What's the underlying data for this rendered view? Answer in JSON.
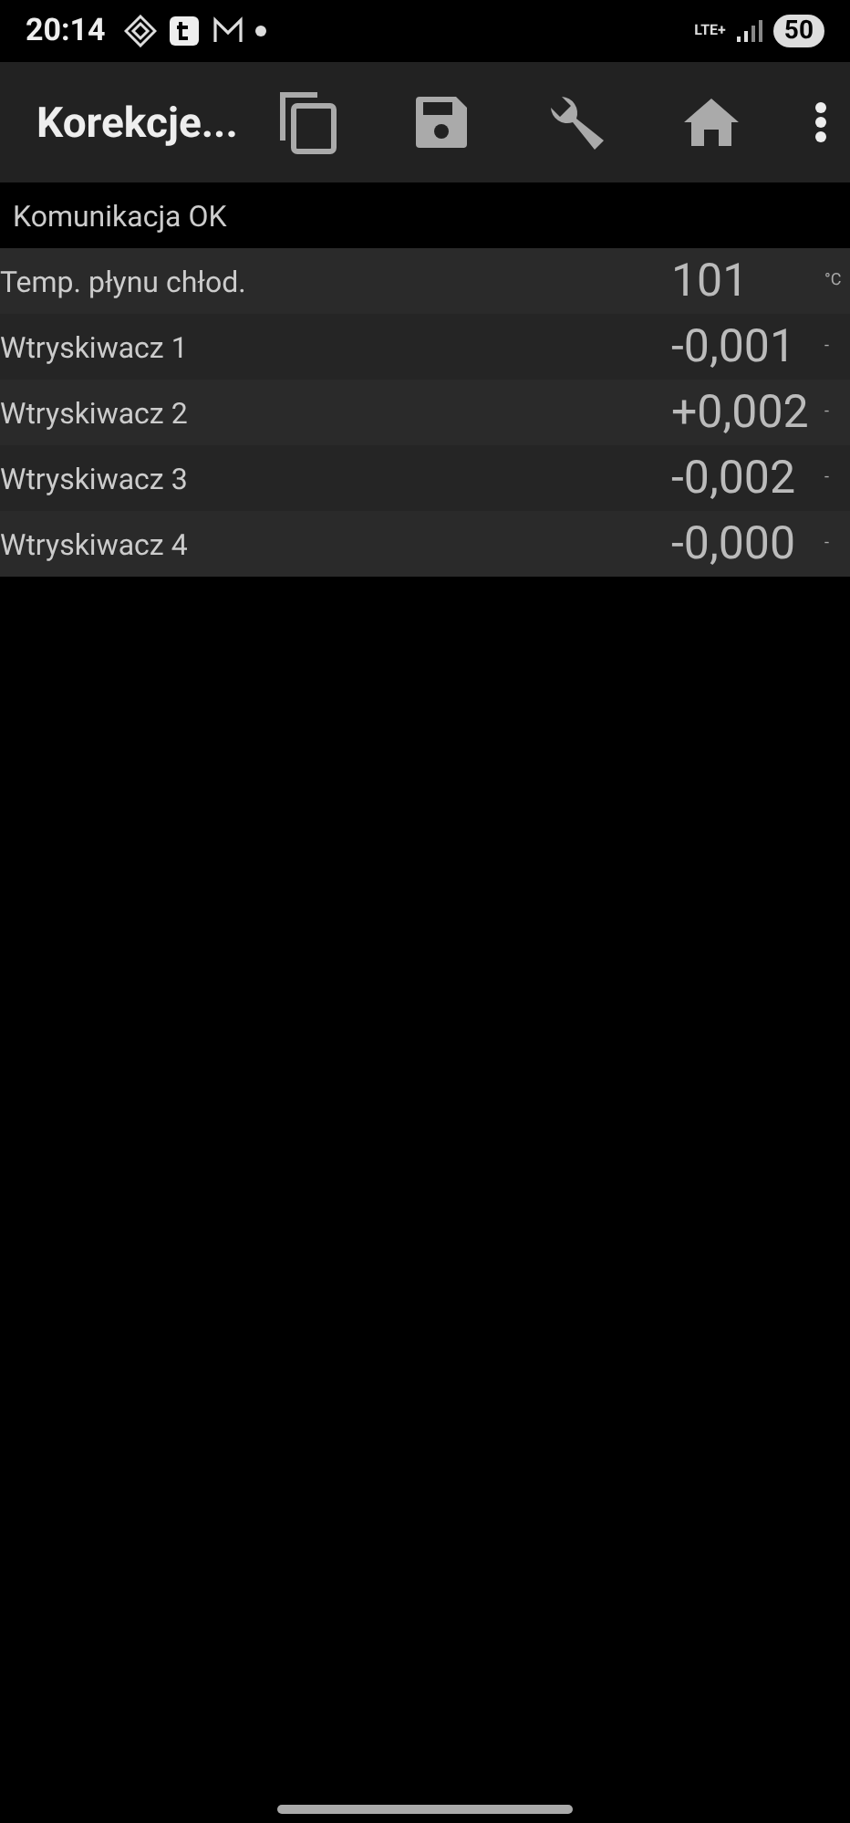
{
  "status_bar": {
    "time": "20:14",
    "network": "LTE+",
    "battery": "50"
  },
  "app_bar": {
    "title": "Korekcje..."
  },
  "status_message": "Komunikacja OK",
  "rows": [
    {
      "label": "Temp. płynu chłod.",
      "value": "101",
      "unit": "°C"
    },
    {
      "label": "Wtryskiwacz 1",
      "value": "-0,001",
      "unit": "-"
    },
    {
      "label": "Wtryskiwacz 2",
      "value": "+0,002",
      "unit": "-"
    },
    {
      "label": "Wtryskiwacz 3",
      "value": "-0,002",
      "unit": "-"
    },
    {
      "label": "Wtryskiwacz 4",
      "value": "-0,000",
      "unit": "-"
    }
  ]
}
